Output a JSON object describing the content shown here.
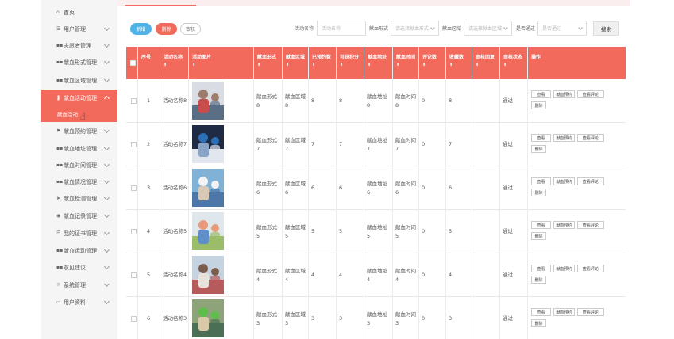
{
  "sidebar": {
    "items": [
      {
        "label": "首页",
        "icon": "home-icon",
        "glyph": "⌂",
        "chevron": false
      },
      {
        "label": "用户管理",
        "icon": "list-icon",
        "glyph": "☰",
        "chevron": true
      },
      {
        "label": "志愿者管理",
        "icon": "grid-icon",
        "glyph": "▪▪",
        "chevron": true
      },
      {
        "label": "献血形式管理",
        "icon": "grid-icon",
        "glyph": "▪▪",
        "chevron": true
      },
      {
        "label": "献血区域管理",
        "icon": "grid-icon",
        "glyph": "▪▪",
        "chevron": true
      },
      {
        "label": "献血活动管理",
        "icon": "bookmark-icon",
        "glyph": "❚",
        "chevron": true,
        "active": true
      },
      {
        "label": "献血预约管理",
        "icon": "flag-icon",
        "glyph": "⚑",
        "chevron": true
      },
      {
        "label": "献血地址管理",
        "icon": "grid-icon",
        "glyph": "▪▪",
        "chevron": true
      },
      {
        "label": "献血时间管理",
        "icon": "grid-icon",
        "glyph": "▪▪",
        "chevron": true
      },
      {
        "label": "献血情况管理",
        "icon": "grid-icon",
        "glyph": "▪▪",
        "chevron": true
      },
      {
        "label": "献血检测管理",
        "icon": "send-icon",
        "glyph": "➤",
        "chevron": true
      },
      {
        "label": "献血记录管理",
        "icon": "camera-icon",
        "glyph": "◉",
        "chevron": true
      },
      {
        "label": "我的证书管理",
        "icon": "list-icon",
        "glyph": "☰",
        "chevron": true
      },
      {
        "label": "献血运动管理",
        "icon": "grid-icon",
        "glyph": "▪▪",
        "chevron": true
      },
      {
        "label": "意见建议",
        "icon": "grid-icon",
        "glyph": "▪▪",
        "chevron": true
      },
      {
        "label": "系统管理",
        "icon": "settings-icon",
        "glyph": "☼",
        "chevron": true
      },
      {
        "label": "用户资料",
        "icon": "file-icon",
        "glyph": "▭",
        "chevron": true
      }
    ],
    "active_sub": "献血活动"
  },
  "toolbar": {
    "add_label": "新增",
    "delete_label": "删除",
    "audit_label": "审核",
    "search_label": "搜索"
  },
  "filters": {
    "name_label": "活动名称",
    "name_placeholder": "活动名称",
    "form_label": "献血形式",
    "form_placeholder": "请选择献血形式",
    "area_label": "献血区域",
    "area_placeholder": "请选择献血区域",
    "pass_label": "是否通过",
    "pass_placeholder": "是否通过"
  },
  "table": {
    "headers": [
      "序号",
      "活动名称",
      "活动图片",
      "献血形式",
      "献血区域",
      "已预约数",
      "可获积分",
      "献血地址",
      "献血时间",
      "评论数",
      "收藏数",
      "审核回复",
      "审核状态",
      "操作"
    ],
    "sort_mark": "⬍",
    "action_labels": [
      "查看",
      "献血预约",
      "查看评论",
      "删除"
    ],
    "rows": [
      {
        "no": "1",
        "name": "活动名称8",
        "form": [
          "献血形式",
          "8"
        ],
        "area": [
          "献血区域",
          "8"
        ],
        "reserved": "8",
        "points": "8",
        "addr": [
          "献血地址",
          "8"
        ],
        "time": [
          "献血时间",
          "8"
        ],
        "comments": "0",
        "favs": "8",
        "status": "通过"
      },
      {
        "no": "2",
        "name": "活动名称7",
        "form": [
          "献血形式",
          "7"
        ],
        "area": [
          "献血区域",
          "7"
        ],
        "reserved": "7",
        "points": "7",
        "addr": [
          "献血地址",
          "7"
        ],
        "time": [
          "献血时间",
          "7"
        ],
        "comments": "0",
        "favs": "7",
        "status": "通过"
      },
      {
        "no": "3",
        "name": "活动名称6",
        "form": [
          "献血形式",
          "6"
        ],
        "area": [
          "献血区域",
          "6"
        ],
        "reserved": "6",
        "points": "6",
        "addr": [
          "献血地址",
          "6"
        ],
        "time": [
          "献血时间",
          "6"
        ],
        "comments": "0",
        "favs": "6",
        "status": "通过"
      },
      {
        "no": "4",
        "name": "活动名称5",
        "form": [
          "献血形式",
          "5"
        ],
        "area": [
          "献血区域",
          "5"
        ],
        "reserved": "5",
        "points": "5",
        "addr": [
          "献血地址",
          "5"
        ],
        "time": [
          "献血时间",
          "5"
        ],
        "comments": "0",
        "favs": "5",
        "status": "通过"
      },
      {
        "no": "5",
        "name": "活动名称4",
        "form": [
          "献血形式",
          "4"
        ],
        "area": [
          "献血区域",
          "4"
        ],
        "reserved": "4",
        "points": "4",
        "addr": [
          "献血地址",
          "4"
        ],
        "time": [
          "献血时间",
          "4"
        ],
        "comments": "0",
        "favs": "4",
        "status": "通过"
      },
      {
        "no": "6",
        "name": "活动名称3",
        "form": [
          "献血形式",
          "3"
        ],
        "area": [
          "献血区域",
          "3"
        ],
        "reserved": "3",
        "points": "3",
        "addr": [
          "献血地址",
          "3"
        ],
        "time": [
          "献血时间",
          "3"
        ],
        "comments": "0",
        "favs": "3",
        "status": "通过"
      }
    ]
  },
  "colors": {
    "accent": "#f26a5c",
    "add": "#4fb3e8",
    "sidebar_bg": "#f5f5f5"
  }
}
